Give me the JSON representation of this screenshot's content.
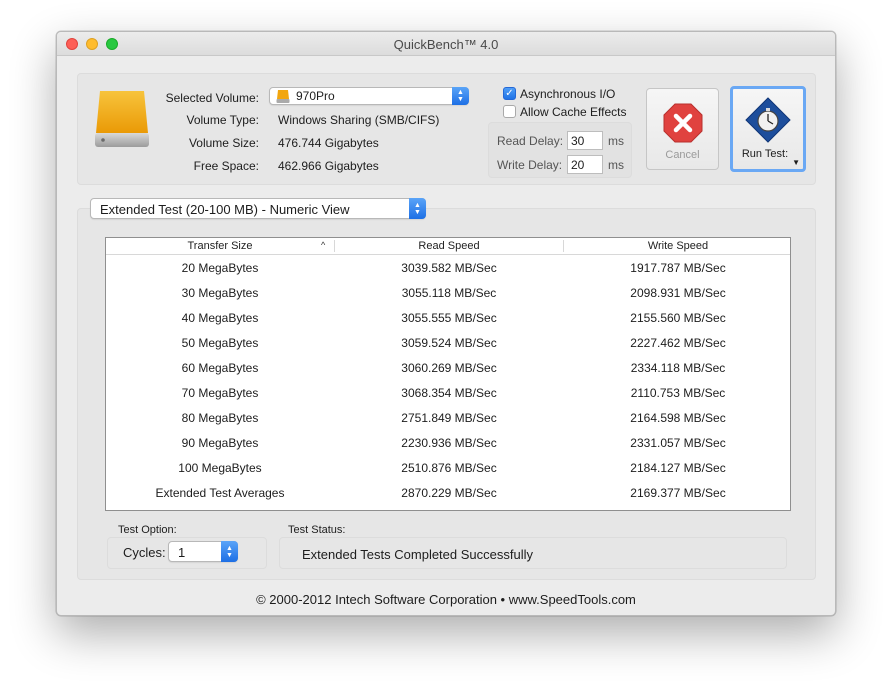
{
  "window": {
    "title": "QuickBench™ 4.0"
  },
  "volume": {
    "selected_label": "Selected Volume:",
    "selected_value": "970Pro",
    "type_label": "Volume Type:",
    "type_value": "Windows Sharing (SMB/CIFS)",
    "size_label": "Volume Size:",
    "size_value": "476.744 Gigabytes",
    "free_label": "Free Space:",
    "free_value": "462.966 Gigabytes"
  },
  "options": {
    "async_label": "Asynchronous I/O",
    "async_checked": true,
    "cache_label": "Allow Cache Effects",
    "cache_checked": false,
    "read_delay_label": "Read Delay:",
    "read_delay_value": "30",
    "read_delay_unit": "ms",
    "write_delay_label": "Write Delay:",
    "write_delay_value": "20",
    "write_delay_unit": "ms"
  },
  "buttons": {
    "cancel": "Cancel",
    "run": "Run Test:"
  },
  "test_view": {
    "selected": "Extended Test (20-100 MB) - Numeric View"
  },
  "table": {
    "columns": [
      "Transfer Size",
      "Read Speed",
      "Write Speed"
    ],
    "rows": [
      [
        "20 MegaBytes",
        "3039.582 MB/Sec",
        "1917.787 MB/Sec"
      ],
      [
        "30 MegaBytes",
        "3055.118 MB/Sec",
        "2098.931 MB/Sec"
      ],
      [
        "40 MegaBytes",
        "3055.555 MB/Sec",
        "2155.560 MB/Sec"
      ],
      [
        "50 MegaBytes",
        "3059.524 MB/Sec",
        "2227.462 MB/Sec"
      ],
      [
        "60 MegaBytes",
        "3060.269 MB/Sec",
        "2334.118 MB/Sec"
      ],
      [
        "70 MegaBytes",
        "3068.354 MB/Sec",
        "2110.753 MB/Sec"
      ],
      [
        "80 MegaBytes",
        "2751.849 MB/Sec",
        "2164.598 MB/Sec"
      ],
      [
        "90 MegaBytes",
        "2230.936 MB/Sec",
        "2331.057 MB/Sec"
      ],
      [
        "100 MegaBytes",
        "2510.876 MB/Sec",
        "2184.127 MB/Sec"
      ],
      [
        "Extended Test Averages",
        "2870.229 MB/Sec",
        "2169.377 MB/Sec"
      ]
    ]
  },
  "test_option": {
    "label": "Test Option:",
    "cycles_label": "Cycles:",
    "cycles_value": "1"
  },
  "test_status": {
    "label": "Test Status:",
    "value": "Extended Tests Completed Successfully"
  },
  "footer": "© 2000-2012 Intech Software Corporation • www.SpeedTools.com",
  "colors": {
    "accent": "#1f72e6",
    "cancel_red": "#e0423f",
    "drive_orange": "#f2a60f"
  }
}
